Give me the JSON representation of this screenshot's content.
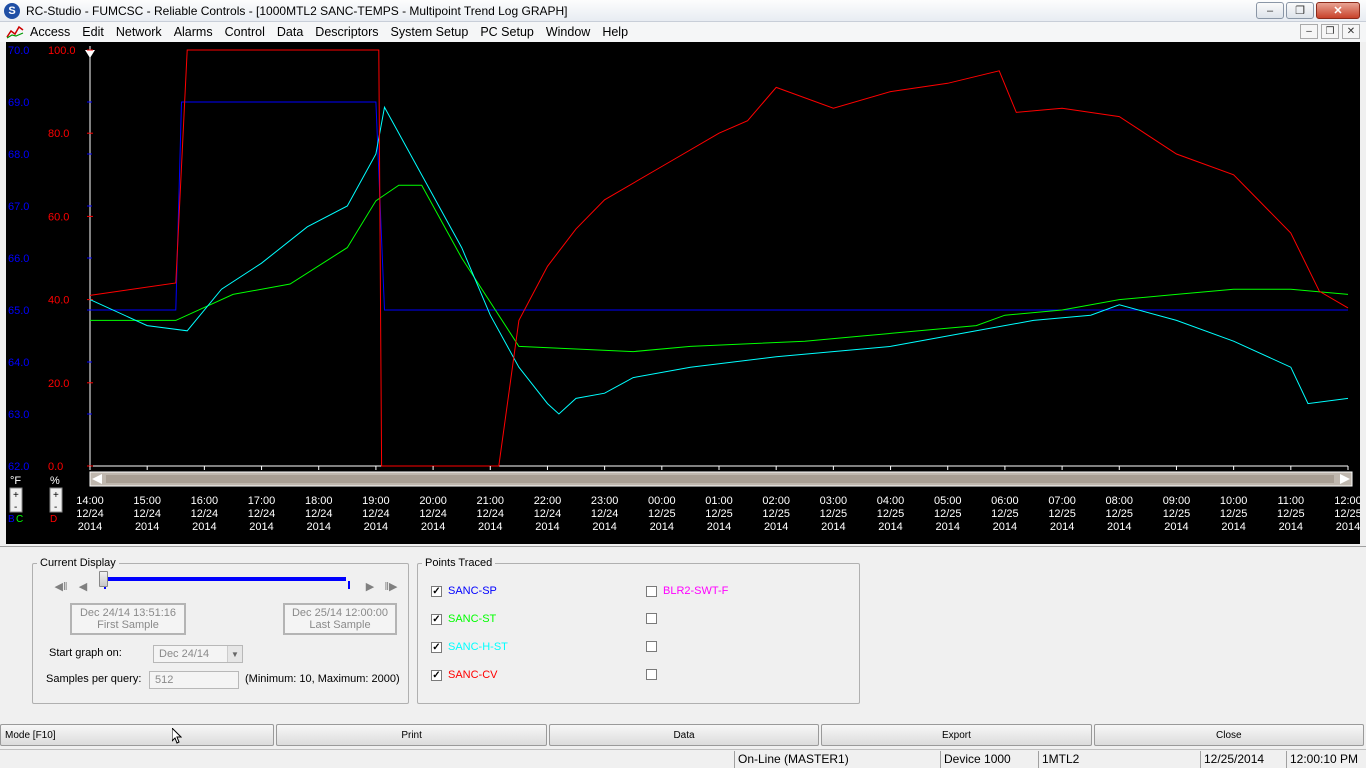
{
  "window": {
    "title": "RC-Studio - FUMCSC - Reliable Controls - [1000MTL2 SANC-TEMPS - Multipoint Trend Log GRAPH]",
    "app_icon": "S"
  },
  "menu": [
    "Access",
    "Edit",
    "Network",
    "Alarms",
    "Control",
    "Data",
    "Descriptors",
    "System Setup",
    "PC Setup",
    "Window",
    "Help"
  ],
  "colors": {
    "sp": "#0000ff",
    "st": "#00ff00",
    "hst": "#00ffff",
    "cv": "#ff0000",
    "blr": "#ff00ff"
  },
  "graph": {
    "units_f": "°F",
    "units_pct": "%",
    "legend_letters": [
      "B",
      "C",
      "D"
    ],
    "y_left_f": [
      "70.0",
      "69.0",
      "68.0",
      "67.0",
      "66.0",
      "65.0",
      "64.0",
      "63.0",
      "62.0"
    ],
    "y_left_pct": [
      "100.0",
      "80.0",
      "60.0",
      "40.0",
      "20.0",
      "0.0"
    ],
    "x_ticks": [
      {
        "time": "14:00",
        "date": "12/24",
        "year": "2014"
      },
      {
        "time": "15:00",
        "date": "12/24",
        "year": "2014"
      },
      {
        "time": "16:00",
        "date": "12/24",
        "year": "2014"
      },
      {
        "time": "17:00",
        "date": "12/24",
        "year": "2014"
      },
      {
        "time": "18:00",
        "date": "12/24",
        "year": "2014"
      },
      {
        "time": "19:00",
        "date": "12/24",
        "year": "2014"
      },
      {
        "time": "20:00",
        "date": "12/24",
        "year": "2014"
      },
      {
        "time": "21:00",
        "date": "12/24",
        "year": "2014"
      },
      {
        "time": "22:00",
        "date": "12/24",
        "year": "2014"
      },
      {
        "time": "23:00",
        "date": "12/24",
        "year": "2014"
      },
      {
        "time": "00:00",
        "date": "12/25",
        "year": "2014"
      },
      {
        "time": "01:00",
        "date": "12/25",
        "year": "2014"
      },
      {
        "time": "02:00",
        "date": "12/25",
        "year": "2014"
      },
      {
        "time": "03:00",
        "date": "12/25",
        "year": "2014"
      },
      {
        "time": "04:00",
        "date": "12/25",
        "year": "2014"
      },
      {
        "time": "05:00",
        "date": "12/25",
        "year": "2014"
      },
      {
        "time": "06:00",
        "date": "12/25",
        "year": "2014"
      },
      {
        "time": "07:00",
        "date": "12/25",
        "year": "2014"
      },
      {
        "time": "08:00",
        "date": "12/25",
        "year": "2014"
      },
      {
        "time": "09:00",
        "date": "12/25",
        "year": "2014"
      },
      {
        "time": "10:00",
        "date": "12/25",
        "year": "2014"
      },
      {
        "time": "11:00",
        "date": "12/25",
        "year": "2014"
      },
      {
        "time": "12:00",
        "date": "12/25",
        "year": "2014"
      }
    ],
    "series_f": [
      {
        "name": "SANC-SP",
        "color": "#0000ff",
        "points": [
          [
            14.0,
            65.0
          ],
          [
            15.5,
            65.0
          ],
          [
            15.6,
            69.0
          ],
          [
            19.0,
            69.0
          ],
          [
            19.15,
            65.0
          ],
          [
            36.0,
            65.0
          ]
        ]
      },
      {
        "name": "SANC-ST",
        "color": "#00ff00",
        "points": [
          [
            14.0,
            64.8
          ],
          [
            15.5,
            64.8
          ],
          [
            16.5,
            65.3
          ],
          [
            17.5,
            65.5
          ],
          [
            18.5,
            66.2
          ],
          [
            19.0,
            67.1
          ],
          [
            19.4,
            67.4
          ],
          [
            19.8,
            67.4
          ],
          [
            20.5,
            66.0
          ],
          [
            21.5,
            64.3
          ],
          [
            23.5,
            64.2
          ],
          [
            24.5,
            64.3
          ],
          [
            26.5,
            64.4
          ],
          [
            27.5,
            64.5
          ],
          [
            28.5,
            64.6
          ],
          [
            29.5,
            64.7
          ],
          [
            30.0,
            64.9
          ],
          [
            31.0,
            65.0
          ],
          [
            32.0,
            65.2
          ],
          [
            33.0,
            65.3
          ],
          [
            34.0,
            65.4
          ],
          [
            35.0,
            65.4
          ],
          [
            36.0,
            65.3
          ]
        ]
      },
      {
        "name": "SANC-H-ST",
        "color": "#00ffff",
        "points": [
          [
            14.0,
            65.2
          ],
          [
            15.0,
            64.7
          ],
          [
            15.7,
            64.6
          ],
          [
            16.3,
            65.4
          ],
          [
            17.0,
            65.9
          ],
          [
            17.8,
            66.6
          ],
          [
            18.5,
            67.0
          ],
          [
            19.0,
            68.0
          ],
          [
            19.15,
            68.9
          ],
          [
            19.6,
            68.0
          ],
          [
            20.5,
            66.2
          ],
          [
            21.0,
            64.9
          ],
          [
            21.5,
            63.9
          ],
          [
            22.0,
            63.2
          ],
          [
            22.2,
            63.0
          ],
          [
            22.5,
            63.3
          ],
          [
            23.0,
            63.4
          ],
          [
            23.5,
            63.7
          ],
          [
            24.5,
            63.9
          ],
          [
            26.0,
            64.1
          ],
          [
            28.0,
            64.3
          ],
          [
            29.5,
            64.6
          ],
          [
            30.5,
            64.8
          ],
          [
            31.5,
            64.9
          ],
          [
            32.0,
            65.1
          ],
          [
            33.0,
            64.8
          ],
          [
            34.0,
            64.4
          ],
          [
            35.0,
            63.9
          ],
          [
            35.3,
            63.2
          ],
          [
            36.0,
            63.3
          ]
        ]
      }
    ],
    "series_pct": [
      {
        "name": "SANC-CV",
        "color": "#ff0000",
        "points": [
          [
            14.0,
            41.0
          ],
          [
            15.5,
            44.0
          ],
          [
            15.7,
            100.0
          ],
          [
            19.05,
            100.0
          ],
          [
            19.1,
            0.0
          ],
          [
            21.15,
            0.0
          ],
          [
            21.5,
            35.0
          ],
          [
            22.0,
            48.0
          ],
          [
            22.5,
            57.0
          ],
          [
            23.0,
            64.0
          ],
          [
            24.0,
            72.0
          ],
          [
            25.0,
            80.0
          ],
          [
            25.5,
            83.0
          ],
          [
            26.0,
            91.0
          ],
          [
            27.0,
            86.0
          ],
          [
            28.0,
            90.0
          ],
          [
            29.0,
            92.0
          ],
          [
            29.9,
            95.0
          ],
          [
            30.2,
            85.0
          ],
          [
            31.0,
            86.0
          ],
          [
            32.0,
            84.0
          ],
          [
            33.0,
            75.0
          ],
          [
            34.0,
            70.0
          ],
          [
            35.0,
            56.0
          ],
          [
            35.5,
            42.0
          ],
          [
            36.0,
            38.0
          ]
        ]
      }
    ]
  },
  "current_display": {
    "legend": "Current Display",
    "first_sample_date": "Dec 24/14 13:51:16",
    "first_sample_label": "First Sample",
    "last_sample_date": "Dec 25/14 12:00:00",
    "last_sample_label": "Last Sample",
    "start_label": "Start graph on:",
    "start_value": "Dec 24/14",
    "samples_label": "Samples per query:",
    "samples_value": "512",
    "samples_hint": "(Minimum: 10, Maximum: 2000)"
  },
  "points_traced": {
    "legend": "Points Traced",
    "items": [
      {
        "label": "SANC-SP",
        "checked": true,
        "color": "#0000ff"
      },
      {
        "label": "SANC-ST",
        "checked": true,
        "color": "#00ff00"
      },
      {
        "label": "SANC-H-ST",
        "checked": true,
        "color": "#00ffff"
      },
      {
        "label": "SANC-CV",
        "checked": true,
        "color": "#ff0000"
      },
      {
        "label": "BLR2-SWT-F",
        "checked": false,
        "color": "#ff00ff"
      },
      {
        "label": "",
        "checked": false,
        "color": "#000000"
      },
      {
        "label": "",
        "checked": false,
        "color": "#000000"
      },
      {
        "label": "",
        "checked": false,
        "color": "#000000"
      }
    ]
  },
  "buttons": {
    "mode": "Mode [F10]",
    "print": "Print",
    "data": "Data",
    "export": "Export",
    "close": "Close"
  },
  "status": {
    "online": "On-Line (MASTER1)",
    "device": "Device 1000",
    "panel": "1MTL2",
    "date": "12/25/2014",
    "time": "12:00:10 PM"
  }
}
